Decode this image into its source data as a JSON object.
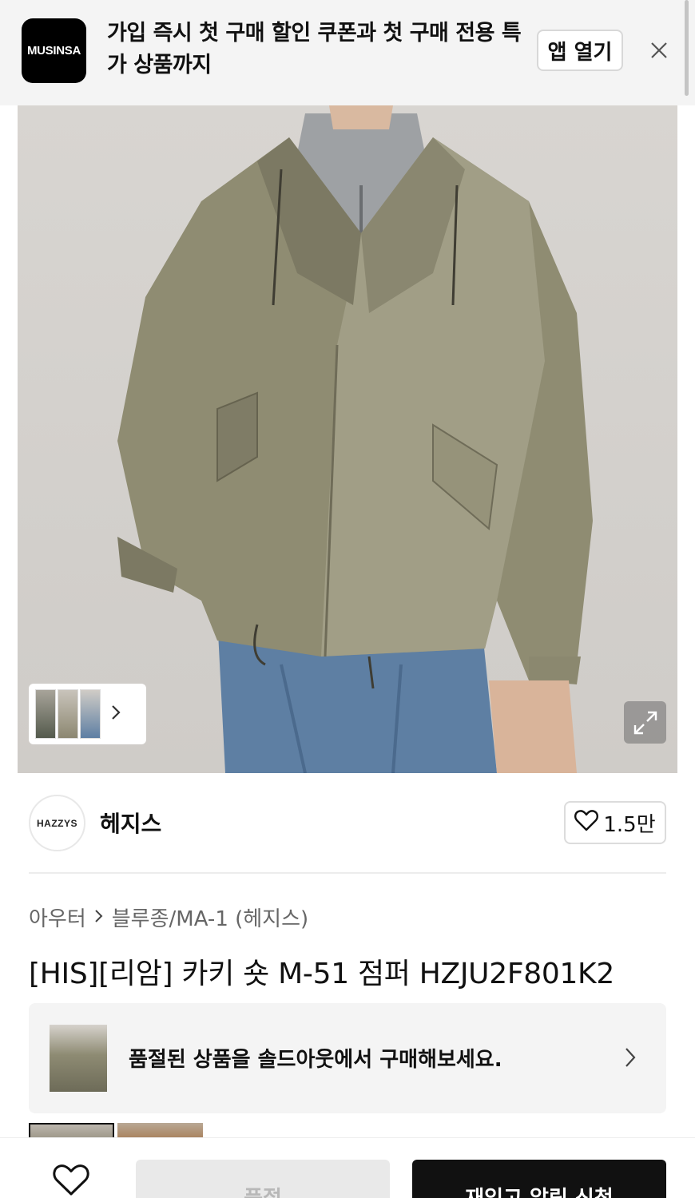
{
  "banner": {
    "logo_text": "MUSINSA",
    "text": "가입 즉시 첫 구매 할인 쿠폰과 첫 구매 전용 특가 상품까지",
    "open_app_label": "앱 열기",
    "close_icon": "close-icon"
  },
  "hero": {
    "icon_next": "chevron-right-icon",
    "icon_expand": "expand-icon"
  },
  "brand": {
    "logo_text": "HAZZYS",
    "name": "헤지스",
    "like_count": "1.5만",
    "like_icon": "heart-icon"
  },
  "product": {
    "category": "아우터",
    "subcategory": "블루종/MA-1 (헤지스)",
    "title": "[HIS][리암] 카키 숏 M-51 점퍼 HZJU2F801K2"
  },
  "soldout_banner": {
    "text": "품절된 상품을 솔드아웃에서 구매해보세요."
  },
  "bottom_bar": {
    "soldout_label": "품절",
    "notify_label": "재입고 알림 신청",
    "heart_icon": "heart-icon"
  },
  "colors": {
    "accent": "#111111",
    "banner_bg": "#f4f4f4",
    "jacket_khaki": "#8f8c72"
  }
}
